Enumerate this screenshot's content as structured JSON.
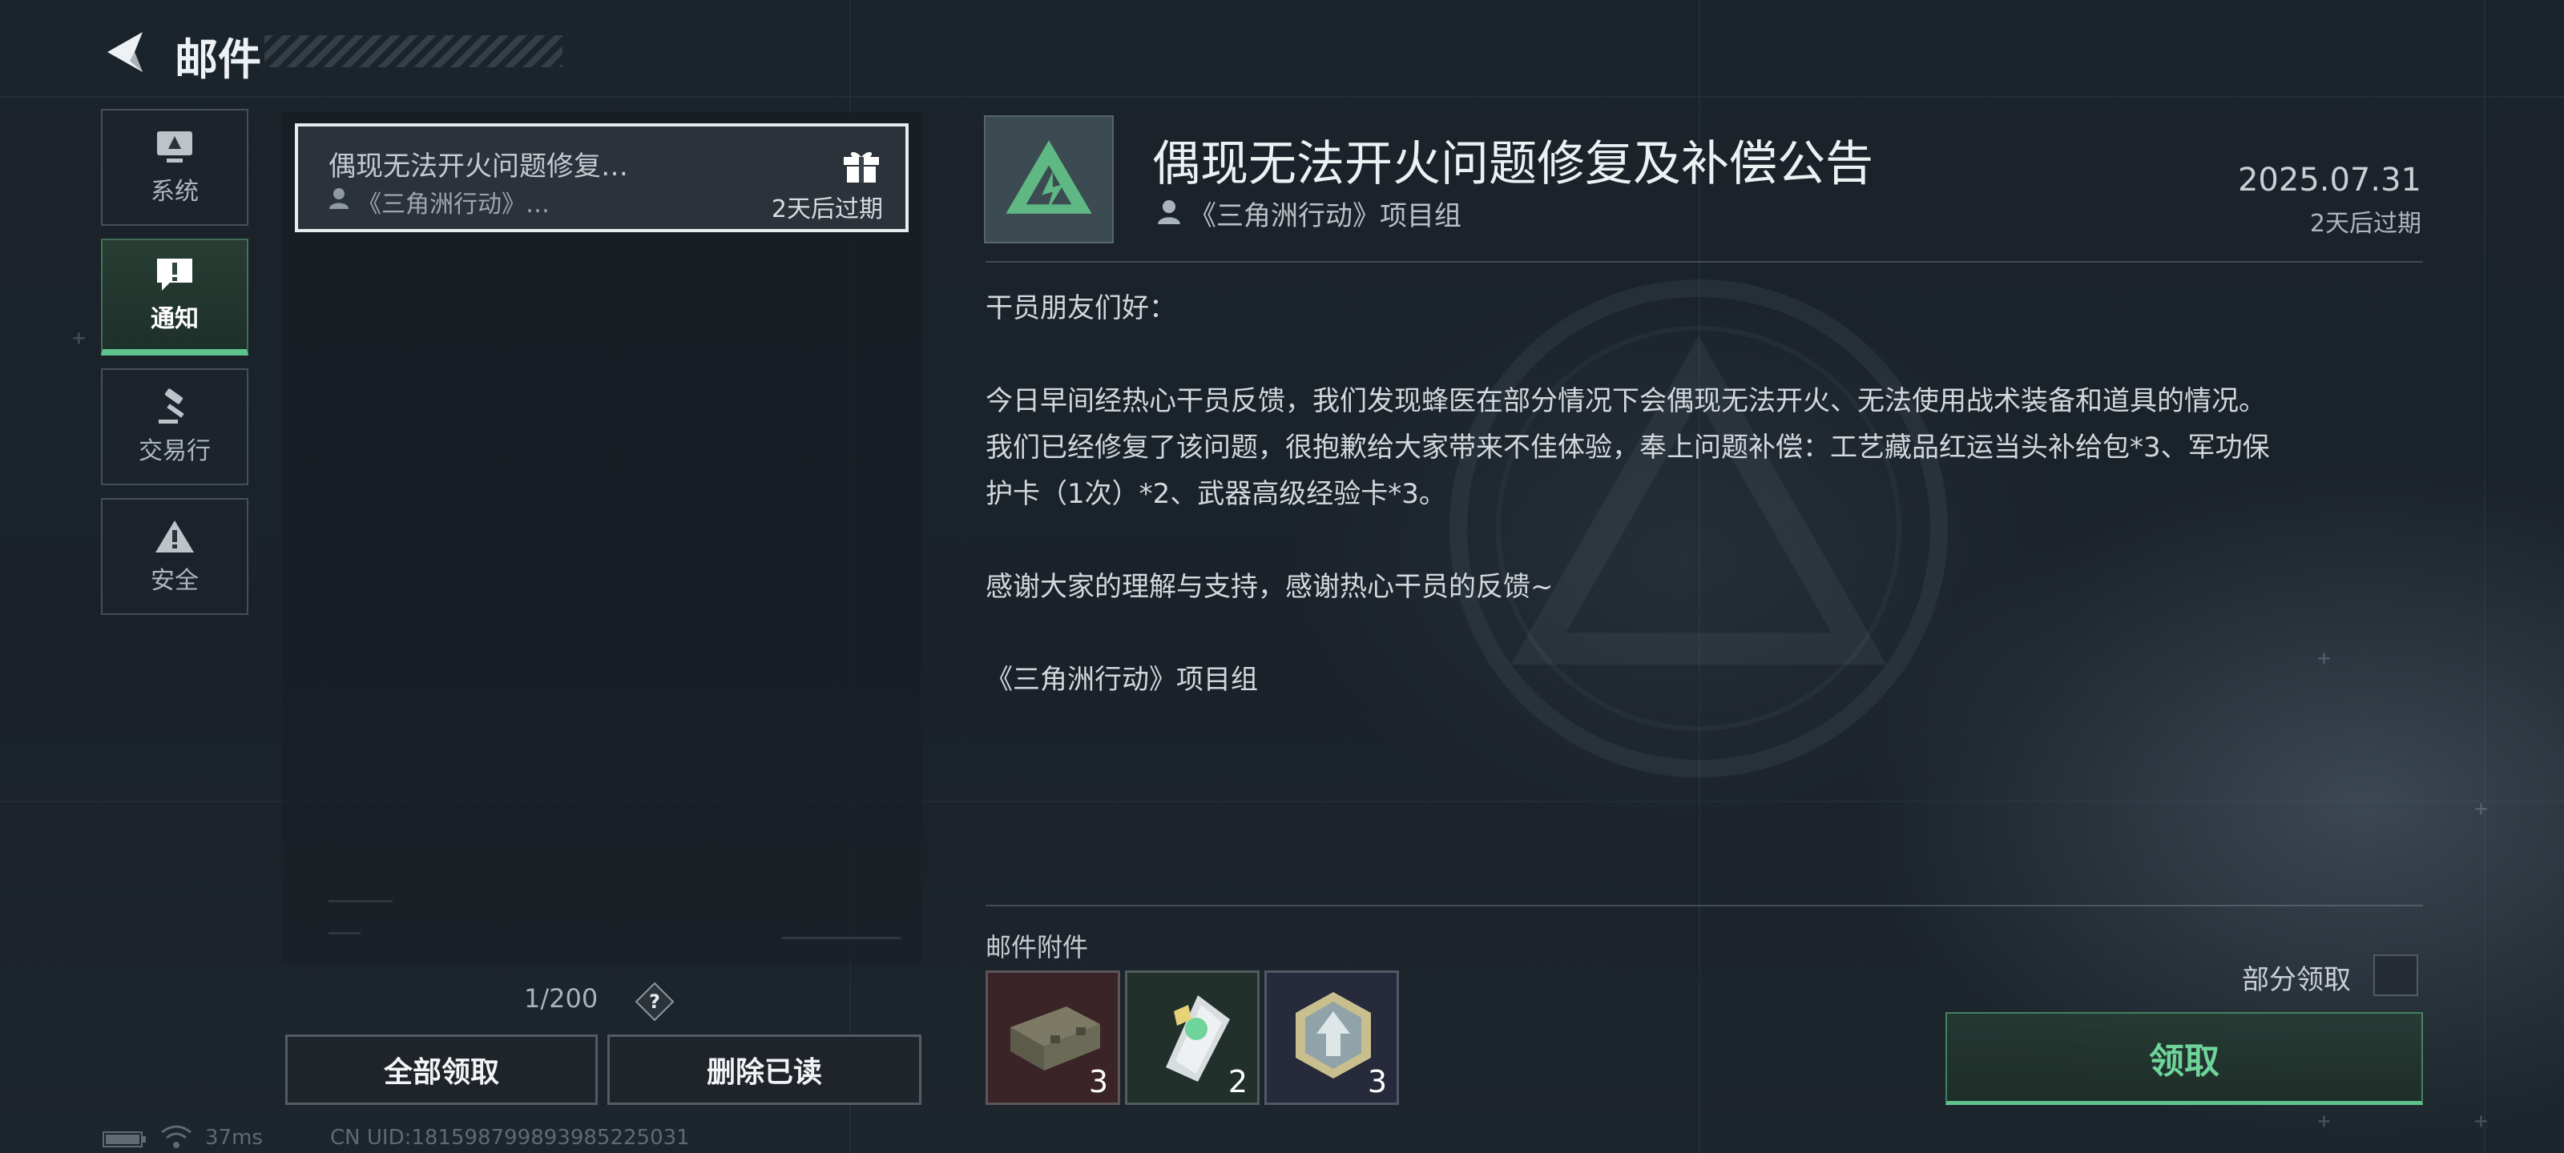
{
  "header": {
    "title": "邮件"
  },
  "nav": {
    "items": [
      {
        "label": "系统",
        "icon": "monitor-icon"
      },
      {
        "label": "通知",
        "icon": "exclamation-icon",
        "active": true
      },
      {
        "label": "交易行",
        "icon": "gavel-icon"
      },
      {
        "label": "安全",
        "icon": "warning-icon"
      }
    ]
  },
  "mail_list": {
    "items": [
      {
        "title": "偶现无法开火问题修复…",
        "sender": "《三角洲行动》…",
        "expire": "2天后过期",
        "icon": "gift-icon"
      }
    ],
    "pager": "1/200",
    "claim_all_label": "全部领取",
    "delete_read_label": "删除已读"
  },
  "status": {
    "ping": "37ms",
    "uid": "CN UID:18159879989398522503​1"
  },
  "detail": {
    "title": "偶现无法开火问题修复及补偿公告",
    "sender": "《三角洲行动》项目组",
    "date": "2025.07.31",
    "expire": "2天后过期",
    "body": [
      "干员朋友们好：",
      "今日早间经热心干员反馈，我们发现蜂医在部分情况下会偶现无法开火、无法使用战术装备和道具的情况。",
      "我们已经修复了该问题，很抱歉给大家带来不佳体验，奉上问题补偿：工艺藏品红运当头补给包*3、军功保",
      "护卡（1次）*2、武器高级经验卡*3。",
      "感谢大家的理解与支持，感谢热心干员的反馈~",
      "《三角洲行动》项目组"
    ],
    "attachments_label": "邮件附件",
    "attachments": [
      {
        "icon": "supply-crate-icon",
        "count": "3",
        "bg": "#3a2427"
      },
      {
        "icon": "protection-card-icon",
        "count": "2",
        "bg": "#22302b"
      },
      {
        "icon": "experience-card-icon",
        "count": "3",
        "bg": "#262a3a"
      }
    ],
    "partial_claim_label": "部分领取",
    "claim_label": "领取"
  },
  "colors": {
    "accent_green": "#5fc48b",
    "background": "#1a2128"
  }
}
